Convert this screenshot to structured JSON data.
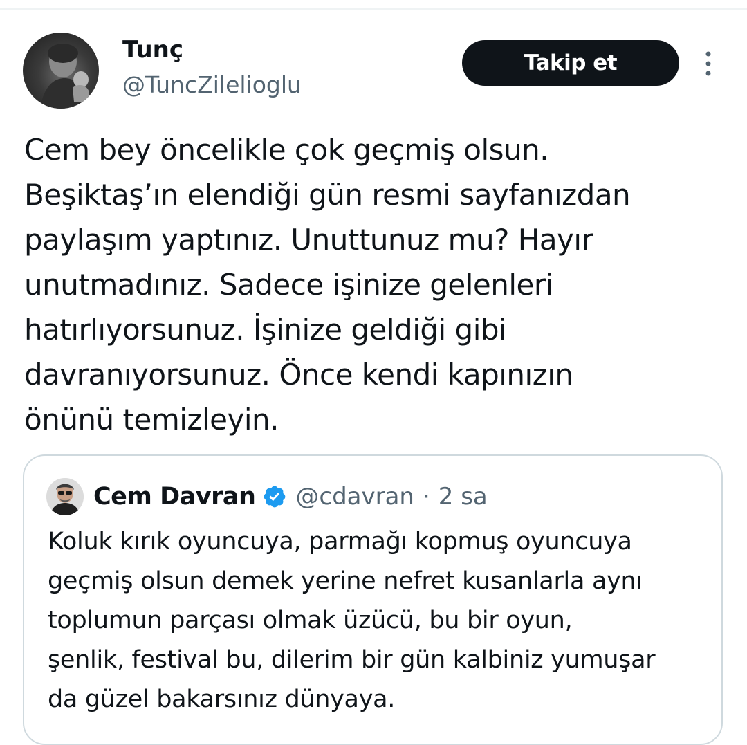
{
  "tweet": {
    "author": {
      "display_name": "Tunç",
      "handle": "@TuncZilelioglu"
    },
    "follow_label": "Takip et",
    "more_icon": "more-vertical-icon",
    "text": "Cem bey öncelikle çok geçmiş olsun.\nBeşiktaş’ın elendiği gün resmi sayfanızdan\npaylaşım yaptınız. Unuttunuz mu? Hayır\nunutmadınız. Sadece işinize gelenleri\nhatırlıyorsunuz. İşinize geldiği gibi\ndavranıyorsunuz. Önce kendi kapınızın\nönünü temizleyin."
  },
  "quote": {
    "author": {
      "display_name": "Cem Davran",
      "verified_icon": "verified-badge-icon",
      "handle": "@cdavran",
      "separator": "·",
      "time": "2 sa"
    },
    "text": "Koluk kırık oyuncuya, parmağı kopmuş oyuncuya\ngeçmiş olsun demek yerine nefret kusanlarla aynı\ntoplumun parçası olmak üzücü, bu bir oyun,\nşenlik, festival bu, dilerim bir gün kalbiniz yumuşar\nda güzel bakarsınız dünyaya."
  },
  "colors": {
    "text_primary": "#0f1419",
    "text_secondary": "#536471",
    "button_bg": "#0f1419",
    "verified_blue": "#1d9bf0",
    "border": "#cfd9de"
  }
}
